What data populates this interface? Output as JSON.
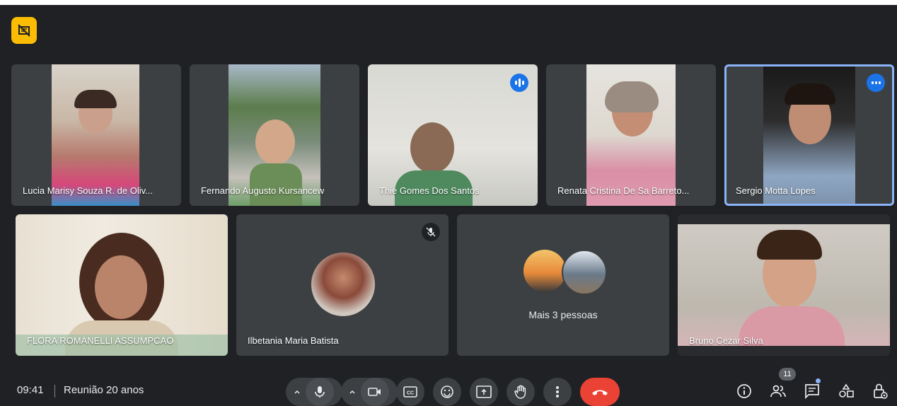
{
  "participants": [
    {
      "name": "Lucia Marisy Souza R. de Oliv...",
      "speaking": false
    },
    {
      "name": "Fernando Augusto Kursancew",
      "speaking": false
    },
    {
      "name": "Thie Gomes Dos Santos",
      "speaking": true
    },
    {
      "name": "Renata Cristina De Sa Barreto...",
      "speaking": false
    },
    {
      "name": "Sergio Motta Lopes",
      "speaking": true
    },
    {
      "name": "FLORA ROMANELLI ASSUMPCAO",
      "speaking": false
    },
    {
      "name": "Ilbetania Maria Batista",
      "muted": true
    },
    {
      "name": "Bruno Cezar Silva",
      "speaking": false
    }
  ],
  "more_tile": {
    "label": "Mais 3 pessoas"
  },
  "bottom_bar": {
    "time": "09:41",
    "meeting_title": "Reunião 20 anos",
    "people_count": "11"
  },
  "icons": {
    "recording": "recording-off-icon",
    "mic": "microphone-icon",
    "camera": "camera-icon",
    "captions": "closed-captions-icon",
    "emoji": "emoji-icon",
    "present": "present-screen-icon",
    "raise_hand": "raise-hand-icon",
    "more": "more-options-icon",
    "end_call": "end-call-icon",
    "info": "info-icon",
    "people": "people-icon",
    "chat": "chat-icon",
    "activities": "activities-icon",
    "host_controls": "host-controls-icon"
  },
  "colors": {
    "background": "#202124",
    "tile": "#3c4043",
    "accent": "#8ab4f8",
    "hangup": "#ea4335",
    "rec": "#fbbc04"
  }
}
